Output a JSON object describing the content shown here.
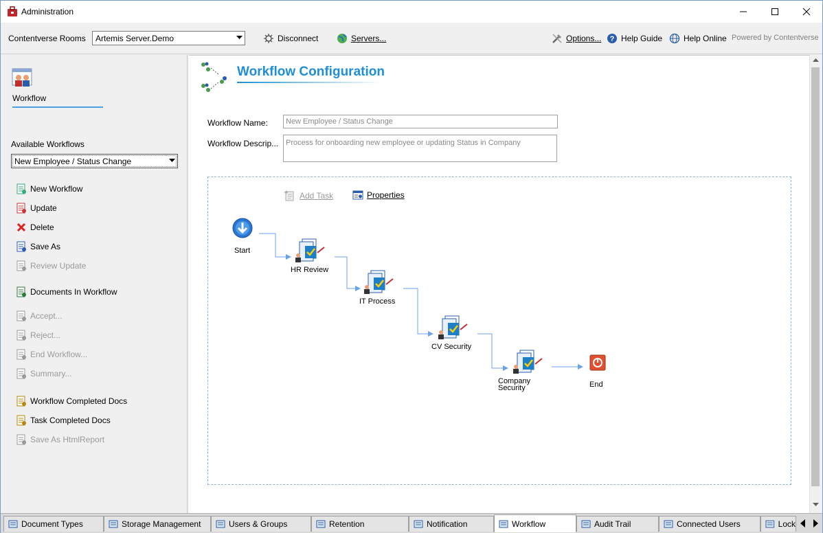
{
  "window": {
    "title": "Administration"
  },
  "toolbar": {
    "rooms_label": "Contentverse Rooms",
    "server_selected": "Artemis Server.Demo",
    "disconnect_label": "Disconnect",
    "servers_label": "Servers...",
    "options_label": "Options...",
    "help_guide_label": "Help Guide",
    "help_online_label": "Help Online",
    "powered_by": "Powered by Contentverse"
  },
  "sidebar": {
    "section_title": "Workflow",
    "available_label": "Available Workflows",
    "selected_workflow": "New Employee / Status Change",
    "actions": [
      {
        "label": "New Workflow",
        "enabled": true,
        "icon": "new-workflow-icon"
      },
      {
        "label": "Update",
        "enabled": true,
        "icon": "update-icon"
      },
      {
        "label": "Delete",
        "enabled": true,
        "icon": "delete-icon"
      },
      {
        "label": "Save As",
        "enabled": true,
        "icon": "save-as-icon"
      },
      {
        "label": "Review Update",
        "enabled": false,
        "icon": "review-update-icon"
      },
      {
        "label": "Documents In Workflow",
        "enabled": true,
        "icon": "documents-in-workflow-icon"
      },
      {
        "label": "Accept...",
        "enabled": false,
        "icon": "accept-icon"
      },
      {
        "label": "Reject...",
        "enabled": false,
        "icon": "reject-icon"
      },
      {
        "label": "End  Workflow...",
        "enabled": false,
        "icon": "end-workflow-icon"
      },
      {
        "label": "Summary...",
        "enabled": false,
        "icon": "summary-icon"
      },
      {
        "label": "Workflow Completed Docs",
        "enabled": true,
        "icon": "workflow-completed-icon"
      },
      {
        "label": "Task Completed Docs",
        "enabled": true,
        "icon": "task-completed-icon"
      },
      {
        "label": "Save As HtmlReport",
        "enabled": false,
        "icon": "html-report-icon"
      }
    ]
  },
  "main": {
    "title": "Workflow Configuration",
    "name_label": "Workflow Name:",
    "name_value": "New Employee / Status Change",
    "desc_label": "Workflow Descrip...",
    "desc_value": "Process for onboarding new employee or updating Status in Company",
    "add_task_label": "Add Task",
    "properties_label": "Properties",
    "nodes": [
      {
        "label": "Start",
        "kind": "start"
      },
      {
        "label": "HR Review",
        "kind": "task"
      },
      {
        "label": "IT Process",
        "kind": "task"
      },
      {
        "label": "CV Security",
        "kind": "task"
      },
      {
        "label": "Company Security",
        "kind": "task"
      },
      {
        "label": "End",
        "kind": "end"
      }
    ]
  },
  "tabs": [
    {
      "label": "Document Types",
      "active": false
    },
    {
      "label": "Storage Management",
      "active": false
    },
    {
      "label": "Users & Groups",
      "active": false
    },
    {
      "label": "Retention",
      "active": false
    },
    {
      "label": "Notification",
      "active": false
    },
    {
      "label": "Workflow",
      "active": true
    },
    {
      "label": "Audit Trail",
      "active": false
    },
    {
      "label": "Connected Users",
      "active": false
    },
    {
      "label": "Lock",
      "active": false
    }
  ],
  "colors": {
    "accent": "#1e8fd6",
    "canvas_border": "#8ab4de",
    "connector": "#6aa2e8"
  }
}
